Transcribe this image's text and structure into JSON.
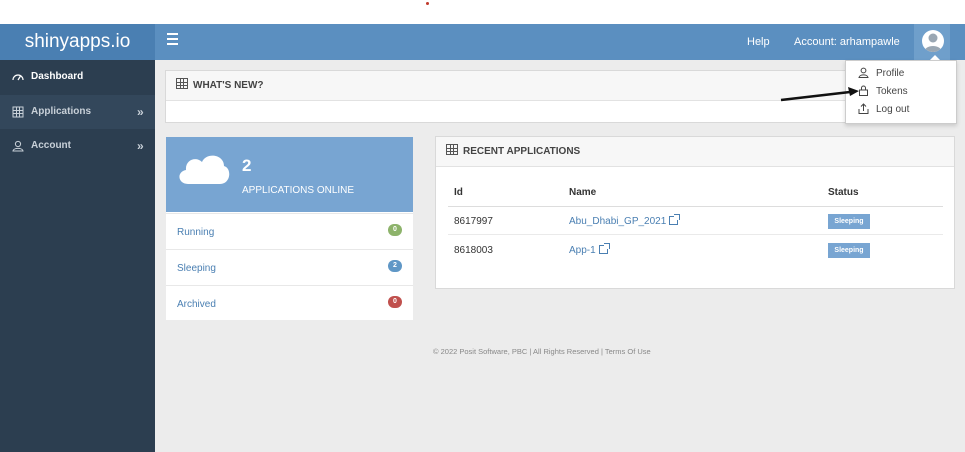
{
  "app": {
    "brand": "shinyapps.io"
  },
  "topnav": {
    "help": "Help",
    "account": "Account: arhampawle"
  },
  "sidebar": {
    "items": [
      {
        "label": "Dashboard",
        "icon": "dashboard-icon"
      },
      {
        "label": "Applications",
        "icon": "grid-icon",
        "chevron": "»"
      },
      {
        "label": "Account",
        "icon": "user-icon",
        "chevron": "»"
      }
    ]
  },
  "whats_new": {
    "title": "WHAT'S NEW?"
  },
  "stats": {
    "count": "2",
    "label": "APPLICATIONS ONLINE",
    "rows": [
      {
        "label": "Running",
        "count": "0",
        "color": "#8db36b"
      },
      {
        "label": "Sleeping",
        "count": "2",
        "color": "#5f97c6"
      },
      {
        "label": "Archived",
        "count": "0",
        "color": "#c0504d"
      }
    ]
  },
  "recent": {
    "title": "RECENT APPLICATIONS",
    "columns": [
      "Id",
      "Name",
      "Status"
    ],
    "rows": [
      {
        "id": "8617997",
        "name": "Abu_Dhabi_GP_2021",
        "status": "Sleeping"
      },
      {
        "id": "8618003",
        "name": "App-1",
        "status": "Sleeping"
      }
    ]
  },
  "footer": {
    "text": "© 2022 Posit Software, PBC | All Rights Reserved | Terms Of Use"
  },
  "dropdown": {
    "items": [
      {
        "label": "Profile",
        "icon": "user-icon"
      },
      {
        "label": "Tokens",
        "icon": "lock-icon"
      },
      {
        "label": "Log out",
        "icon": "logout-icon"
      }
    ]
  },
  "colors": {
    "navbar": "#5b8fc0",
    "sidebar": "#2c3e50",
    "accent": "#78a5d2",
    "link": "#4a7fb2"
  }
}
